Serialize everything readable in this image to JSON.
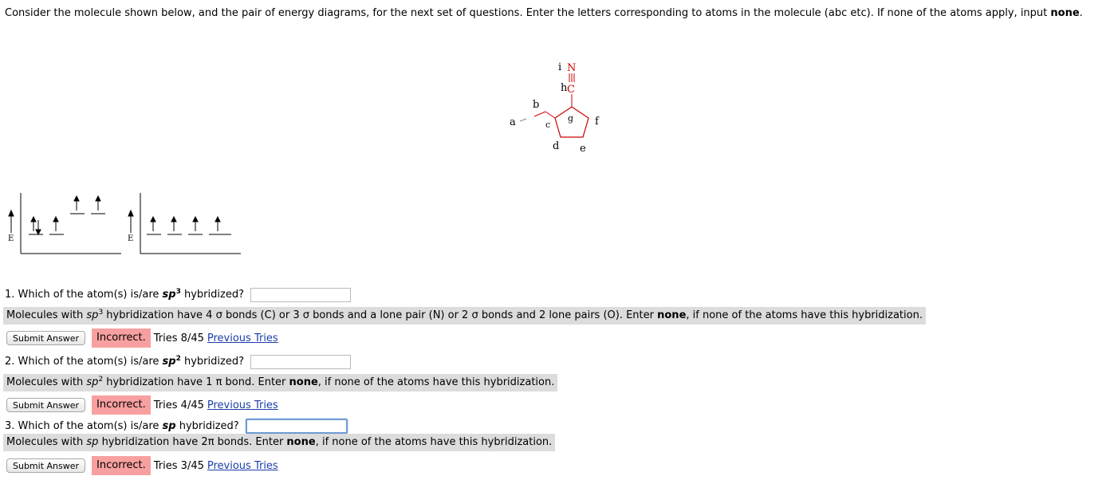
{
  "intro": {
    "text": "Consider the molecule shown below, and the pair of energy diagrams, for the next set of questions. Enter the letters corresponding to atoms in the molecule (abc etc). If none of the atoms apply, input",
    "bold": "none",
    "end": "."
  },
  "molecule": {
    "labels": {
      "i": "i",
      "N": "N",
      "h": "h",
      "C": "C",
      "b": "b",
      "a": "a",
      "c": "c",
      "g": "g",
      "f": "f",
      "d": "d",
      "e": "e"
    }
  },
  "diagrams": {
    "axis_label": "E"
  },
  "questions": [
    {
      "prefix": "1. Which of the atom(s) is/are ",
      "hyb": "sp",
      "sup": "3",
      "suffix": " hybridized?",
      "input_value": "",
      "hint_pre": "Molecules with ",
      "hint_hyb": "sp",
      "hint_sup": "3",
      "hint_mid": " hybridization have 4 σ bonds (C) or 3 σ bonds and a lone pair (N) or 2 σ bonds and 2 lone pairs (O). Enter ",
      "hint_bold": "none",
      "hint_post": ", if none of the atoms have this hybridization.",
      "button": "Submit Answer",
      "status": "Incorrect.",
      "tries": "Tries 8/45",
      "link": "Previous Tries"
    },
    {
      "prefix": "2. Which of the atom(s) is/are ",
      "hyb": "sp",
      "sup": "2",
      "suffix": " hybridized?",
      "input_value": "",
      "hint_pre": "Molecules with ",
      "hint_hyb": "sp",
      "hint_sup": "2",
      "hint_mid": " hybridization have 1 π bond. Enter ",
      "hint_bold": "none",
      "hint_post": ", if none of the atoms have this hybridization.",
      "button": "Submit Answer",
      "status": "Incorrect.",
      "tries": "Tries 4/45",
      "link": "Previous Tries"
    },
    {
      "prefix": "3. Which of the atom(s) is/are ",
      "hyb": "sp",
      "suffix": " hybridized?",
      "input_value": "",
      "hint_pre": "Molecules with ",
      "hint_hyb": "sp",
      "hint_mid": " hybridization have 2π bonds. Enter ",
      "hint_bold": "none",
      "hint_post": ", if none of the atoms have this hybridization.",
      "button": "Submit Answer",
      "status": "Incorrect.",
      "tries": "Tries 3/45",
      "link": "Previous Tries"
    }
  ],
  "colors": {
    "hint_bg": "#dcdcdc",
    "incorrect_bg": "#f8a0a0",
    "link": "#1a3ea8",
    "molecule_red": "#cc0000"
  }
}
